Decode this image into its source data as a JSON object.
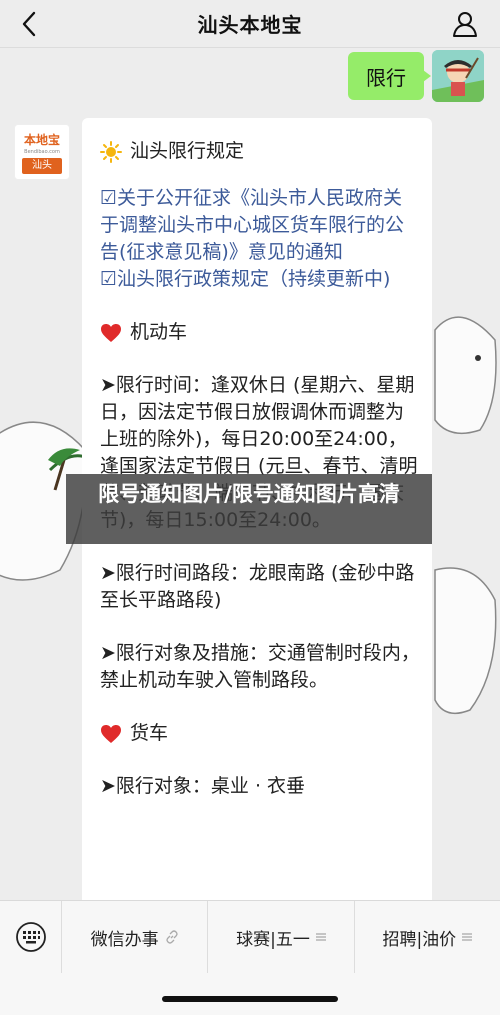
{
  "header": {
    "title": "汕头本地宝",
    "back_icon": "chevron-left-icon",
    "profile_icon": "person-icon"
  },
  "user_message": {
    "text": "限行",
    "bubble_color": "#95ec69"
  },
  "bot": {
    "avatar": {
      "logo_text": "本地宝",
      "logo_sub": "Bendibao.com",
      "city_tag": "汕头"
    },
    "section_title": "汕头限行规定",
    "links": [
      "☑关于公开征求《汕头市人民政府关于调整汕头市中心城区货车限行的公告(征求意见稿)》意见的通知",
      "☑汕头限行政策规定（持续更新中)"
    ],
    "motor_title": "机动车",
    "motor_time": "➤限行时间：逢双休日 (星期六、星期日，因法定节假日放假调休而调整为上班的除外)，每日20:00至24:00，逢国家法定节假日 (元旦、春节、清明节、劳动节、端午节、中秋节、国庆节)，每日15:00至24:00。",
    "motor_road": "➤限行时间路段：龙眼南路 (金砂中路至长平路路段)",
    "motor_target": "➤限行对象及措施：交通管制时段内，禁止机动车驶入管制路段。",
    "truck_title": "货车",
    "truck_partial": "➤限行对象：桌业 · 衣垂"
  },
  "watermark": {
    "text": "限号通知图片/限号通知图片高清"
  },
  "bottom_menu": {
    "keyboard_icon": "keyboard-icon",
    "items": [
      {
        "label": "微信办事",
        "icon": "link-icon"
      },
      {
        "label": "球赛|五一",
        "icon": "menu-icon"
      },
      {
        "label": "招聘|油价",
        "icon": "menu-icon"
      }
    ]
  },
  "colors": {
    "accent_link": "#3c5a99",
    "brand_orange": "#e0621e",
    "heart_red": "#e02a2a"
  }
}
